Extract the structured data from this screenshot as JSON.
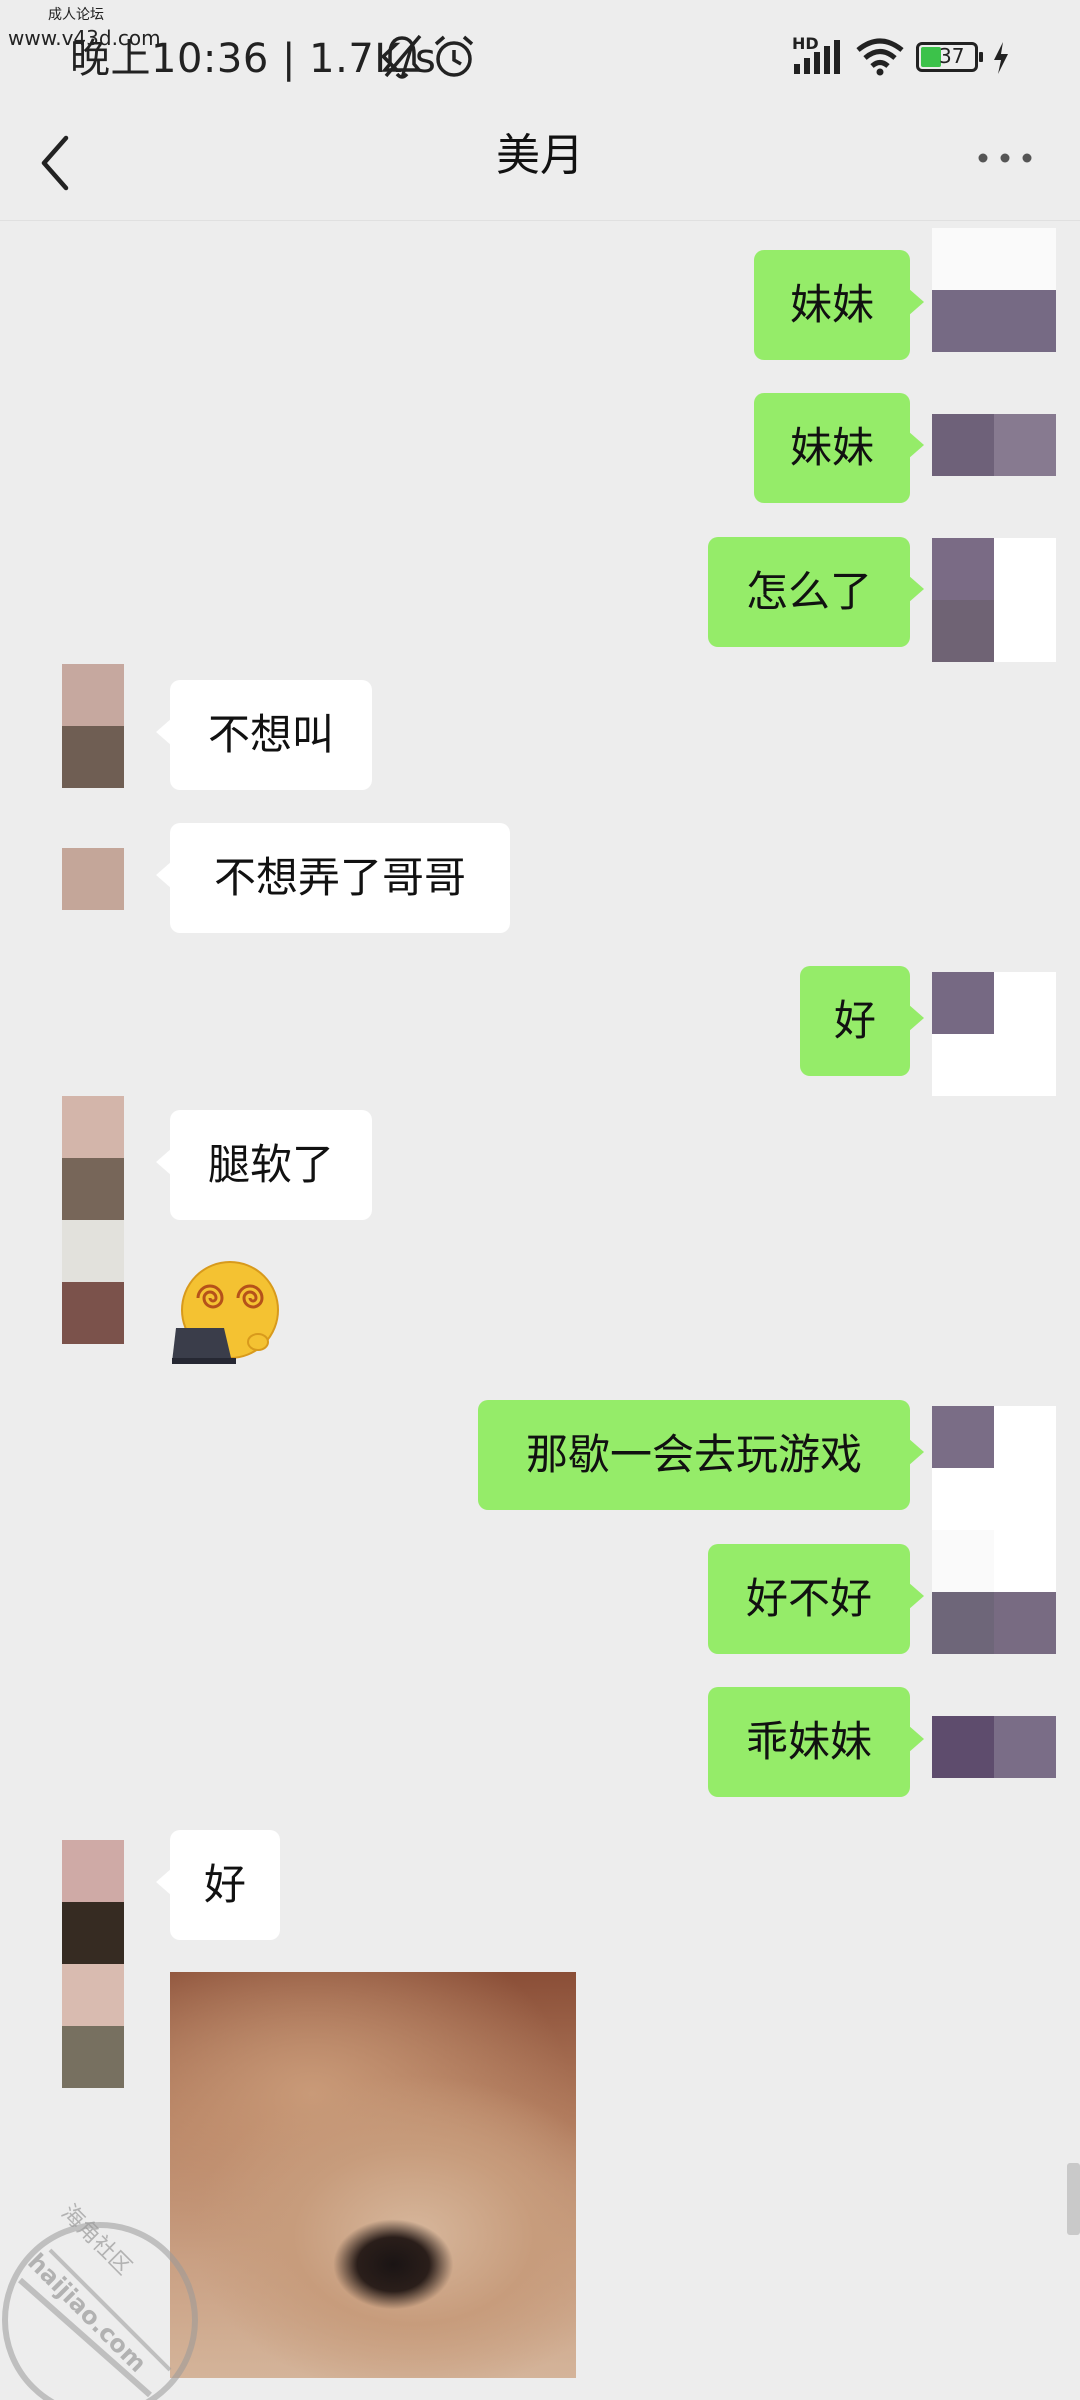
{
  "watermark": {
    "top_text": "成人论坛",
    "top_url": "www.v43d.com",
    "bottom_brand": "海角社区",
    "bottom_url": "haijiao.com"
  },
  "status_bar": {
    "time_text": "晚上10:36 | 1.7K/s",
    "network_label": "HD",
    "battery_level": "37",
    "icons": [
      "mute-bell-icon",
      "alarm-icon",
      "signal-icon",
      "wifi-icon",
      "battery-icon",
      "charging-icon"
    ]
  },
  "nav": {
    "title": "美月",
    "back_icon": "chevron-left-icon",
    "more_icon": "more-dots-icon"
  },
  "messages": [
    {
      "side": "right",
      "text": "妹妹"
    },
    {
      "side": "right",
      "text": "妹妹"
    },
    {
      "side": "right",
      "text": "怎么了"
    },
    {
      "side": "left",
      "text": "不想叫"
    },
    {
      "side": "left",
      "text": "不想弄了哥哥"
    },
    {
      "side": "right",
      "text": "好"
    },
    {
      "side": "left",
      "text": "腿软了"
    },
    {
      "side": "left",
      "type": "emoji",
      "emoji": "dizzy-laptop-face"
    },
    {
      "side": "right",
      "text": "那歇一会去玩游戏"
    },
    {
      "side": "right",
      "text": "好不好"
    },
    {
      "side": "right",
      "text": "乖妹妹"
    },
    {
      "side": "left",
      "text": "好"
    },
    {
      "side": "left",
      "type": "image",
      "image": "blurred-dog-eye-photo"
    }
  ],
  "colors": {
    "background": "#ededed",
    "bubble_sent": "#95ec69",
    "bubble_received": "#ffffff"
  }
}
